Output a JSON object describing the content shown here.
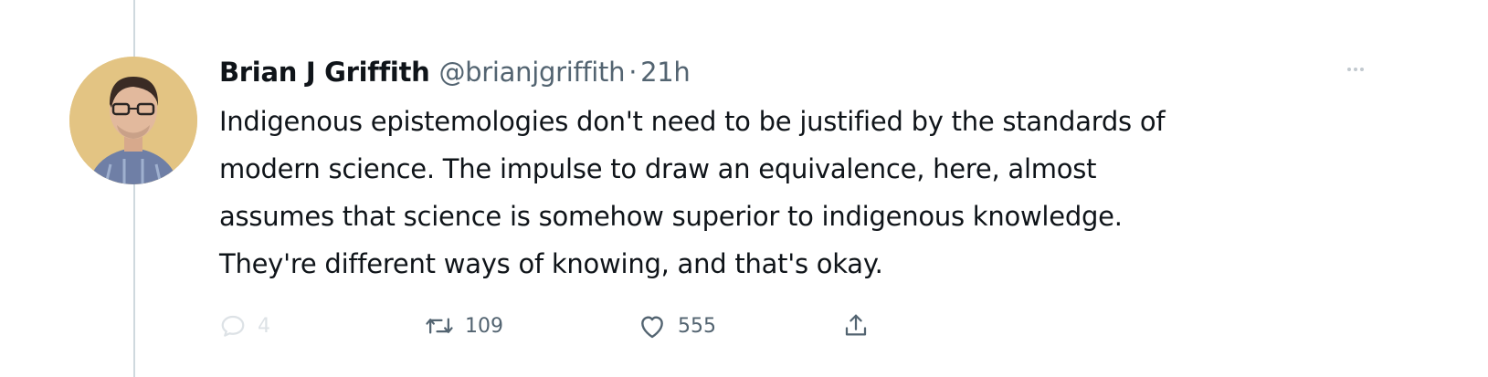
{
  "tweet": {
    "author": {
      "display_name": "Brian J Griffith",
      "handle": "@brianjgriffith",
      "separator": "·",
      "timestamp": "21h"
    },
    "text_lines": [
      "Indigenous epistemologies don't need to be justified by the standards of",
      "modern science. The impulse to draw an equivalence, here, almost",
      "assumes that science is somehow superior to indigenous knowledge.",
      "They're different ways of knowing, and that's okay."
    ],
    "actions": {
      "reply": {
        "icon": "reply-icon",
        "count": "4"
      },
      "retweet": {
        "icon": "retweet-icon",
        "count": "109"
      },
      "like": {
        "icon": "heart-icon",
        "count": "555"
      },
      "share": {
        "icon": "share-icon"
      }
    },
    "more_icon": "more-options-icon"
  },
  "colors": {
    "text_primary": "#0f1419",
    "text_secondary": "#536471",
    "thread_line": "#cfd9de",
    "avatar_background": "#e3c483"
  }
}
